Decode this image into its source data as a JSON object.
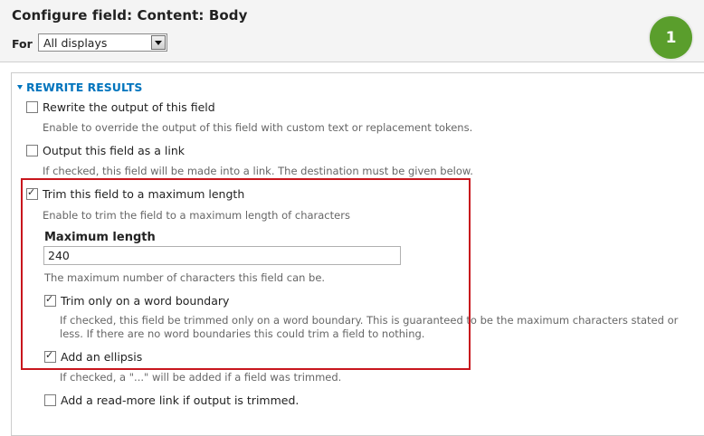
{
  "header": {
    "title": "Configure field: Content: Body",
    "for_label": "For",
    "display_select_value": "All displays",
    "step_badge": "1"
  },
  "section": {
    "title": "REWRITE RESULTS"
  },
  "options": {
    "rewrite": {
      "label": "Rewrite the output of this field",
      "checked": false,
      "description": "Enable to override the output of this field with custom text or replacement tokens."
    },
    "link": {
      "label": "Output this field as a link",
      "checked": false,
      "description": "If checked, this field will be made into a link. The destination must be given below."
    },
    "trim": {
      "label": "Trim this field to a maximum length",
      "checked": true,
      "description": "Enable to trim the field to a maximum length of characters"
    },
    "max_length": {
      "label": "Maximum length",
      "value": "240",
      "description": "The maximum number of characters this field can be."
    },
    "word_boundary": {
      "label": "Trim only on a word boundary",
      "checked": true,
      "description_line1": "If checked, this field be trimmed only on a word boundary. This is guaranteed to be the maximum characters stated or",
      "description_line2": "less. If there are no word boundaries this could trim a field to nothing."
    },
    "ellipsis": {
      "label": "Add an ellipsis",
      "checked": true,
      "description": "If checked, a \"...\" will be added if a field was trimmed."
    },
    "read_more": {
      "label": "Add a read-more link if output is trimmed.",
      "checked": false
    }
  },
  "colors": {
    "link_blue": "#0074bd",
    "highlight_red": "#c8161d",
    "badge_green": "#5a9e2c"
  }
}
